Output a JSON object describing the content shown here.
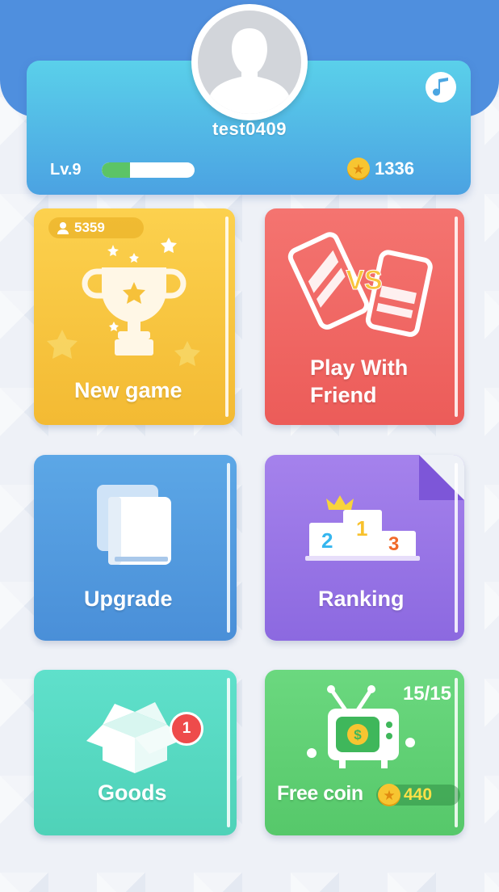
{
  "profile": {
    "username": "test0409",
    "level_label": "Lv.9",
    "xp_progress": 0.3,
    "coins": "1336"
  },
  "icons": {
    "avatar": "person-silhouette-icon",
    "music": "music-note-icon",
    "coin": "star-coin-icon"
  },
  "tiles": {
    "new_game": {
      "label": "New game",
      "players": "5359",
      "icon": "trophy-icon"
    },
    "play_with_friend": {
      "label_line1": "Play With",
      "label_line2": "Friend",
      "icon": "vs-phones-icon"
    },
    "upgrade": {
      "label": "Upgrade",
      "icon": "books-icon"
    },
    "ranking": {
      "label": "Ranking",
      "icon": "podium-icon",
      "podium": [
        "2",
        "1",
        "3"
      ]
    },
    "goods": {
      "label": "Goods",
      "badge": "1",
      "icon": "box-icon"
    },
    "free_coin": {
      "label": "Free coin",
      "counter": "15/15",
      "reward": "440",
      "icon": "tv-icon"
    }
  },
  "colors": {
    "header": "#4f8fde",
    "new_game": "#f6c13a",
    "play_with_friend": "#ee6461",
    "upgrade": "#4f97dd",
    "ranking": "#9574e6",
    "goods": "#55d9c1",
    "free_coin": "#5fd073"
  }
}
